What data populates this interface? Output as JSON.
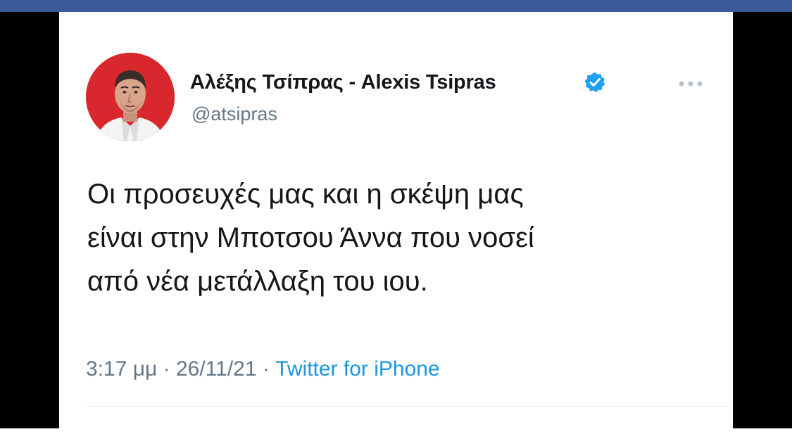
{
  "tweet": {
    "display_name": "Αλέξης Τσίπρας - Alexis Tsipras",
    "handle": "@atsipras",
    "text_lines": [
      "Οι προσευχές μας και η σκέψη μας",
      "είναι στην Μποτσου Άννα που νοσεί",
      "από νέα μετάλλαξη του ιου."
    ],
    "time": "3:17 μμ",
    "separator": " · ",
    "date": "26/11/21",
    "source": "Twitter for iPhone"
  },
  "icons": {
    "verified": "verified-badge-icon",
    "more": "more-options-icon",
    "avatar": "profile-photo"
  },
  "colors": {
    "facebook_bar": "#3b5998",
    "verified_blue": "#1da1f2",
    "link_blue": "#1b95e0",
    "avatar_bg": "#d8282e"
  }
}
